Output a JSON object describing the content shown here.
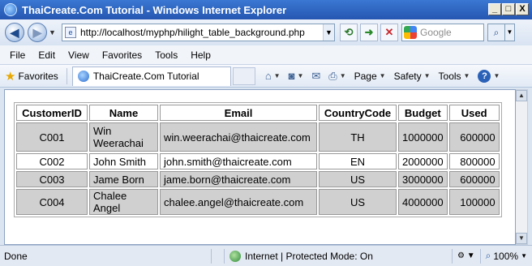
{
  "window": {
    "title": "ThaiCreate.Com Tutorial - Windows Internet Explorer",
    "min": "_",
    "max": "□",
    "close": "X"
  },
  "address": {
    "url": "http://localhost/myphp/hilight_table_background.php"
  },
  "search": {
    "placeholder": "Google"
  },
  "menu": [
    "File",
    "Edit",
    "View",
    "Favorites",
    "Tools",
    "Help"
  ],
  "favorites": {
    "label": "Favorites",
    "tab_title": "ThaiCreate.Com Tutorial"
  },
  "commands": {
    "page": "Page",
    "safety": "Safety",
    "tools": "Tools"
  },
  "table": {
    "headers": [
      "CustomerID",
      "Name",
      "Email",
      "CountryCode",
      "Budget",
      "Used"
    ],
    "rows": [
      [
        "C001",
        "Win Weerachai",
        "win.weerachai@thaicreate.com",
        "TH",
        "1000000",
        "600000"
      ],
      [
        "C002",
        "John Smith",
        "john.smith@thaicreate.com",
        "EN",
        "2000000",
        "800000"
      ],
      [
        "C003",
        "Jame Born",
        "jame.born@thaicreate.com",
        "US",
        "3000000",
        "600000"
      ],
      [
        "C004",
        "Chalee Angel",
        "chalee.angel@thaicreate.com",
        "US",
        "4000000",
        "100000"
      ]
    ]
  },
  "status": {
    "text": "Done",
    "zone": "Internet | Protected Mode: On",
    "zoom": "100%"
  },
  "colors": {
    "highlight_row": "#d0d0d0",
    "title_bar": "#2c5fc0"
  }
}
